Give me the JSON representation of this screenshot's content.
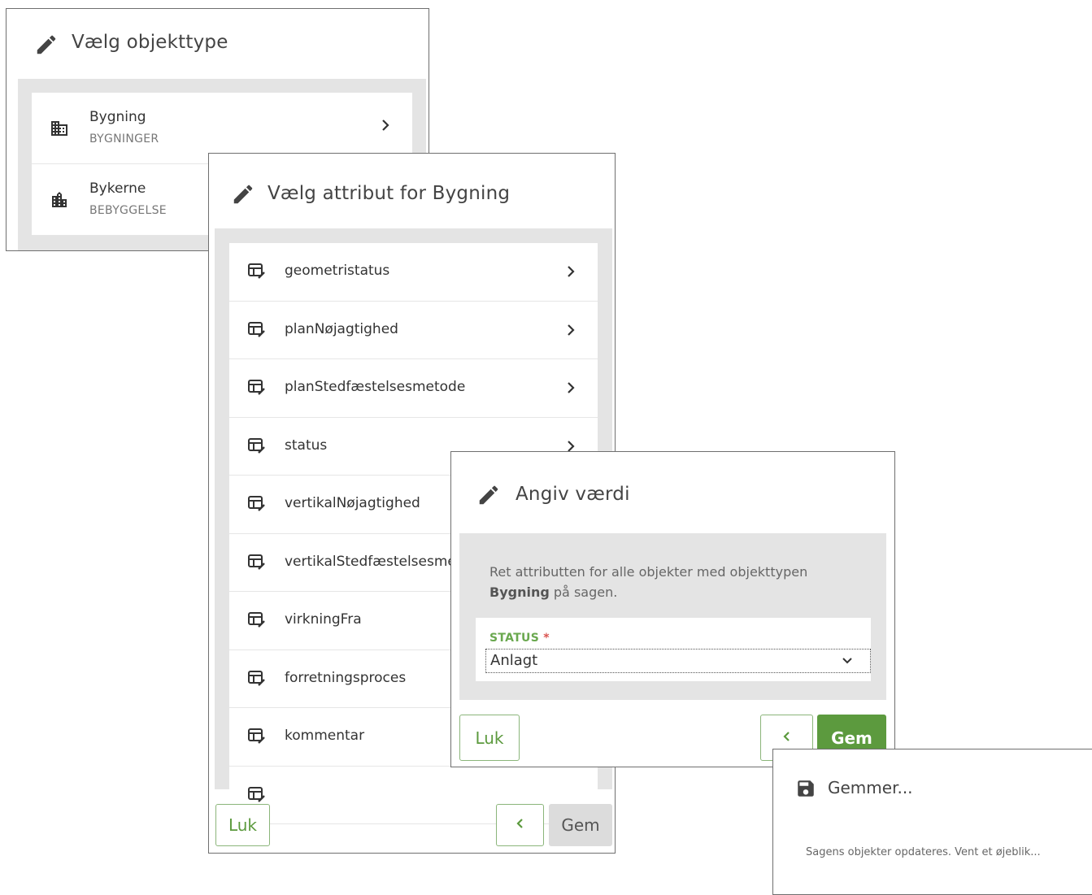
{
  "dialog_object_type": {
    "title": "Vælg objekttype",
    "items": [
      {
        "name": "Bygning",
        "category": "BYGNINGER",
        "icon": "building-icon"
      },
      {
        "name": "Bykerne",
        "category": "BEBYGGELSE",
        "icon": "city-icon"
      }
    ]
  },
  "dialog_attribute": {
    "title": "Vælg attribut for Bygning",
    "items": [
      "geometristatus",
      "planNøjagtighed",
      "planStedfæstelsesmetode",
      "status",
      "vertikalNøjagtighed",
      "vertikalStedfæstelsesmetode",
      "virkningFra",
      "forretningsproces",
      "kommentar"
    ],
    "close_label": "Luk",
    "back_label": "<",
    "save_label": "Gem"
  },
  "dialog_value": {
    "title": "Angiv værdi",
    "description_prefix": "Ret attributten for alle objekter med objekttypen",
    "description_bold": "Bygning",
    "description_suffix": "på sagen.",
    "field_label": "STATUS",
    "required_mark": "*",
    "field_value": "Anlagt",
    "close_label": "Luk",
    "back_label": "<",
    "save_label": "Gem"
  },
  "dialog_saving": {
    "title": "Gemmer...",
    "message": "Sagens objekter opdateres. Vent et øjeblik..."
  },
  "colors": {
    "accent_green": "#5c9a3e",
    "label_green": "#6aa84f",
    "required_red": "#d9534f",
    "panel_gray": "#e4e4e4"
  }
}
